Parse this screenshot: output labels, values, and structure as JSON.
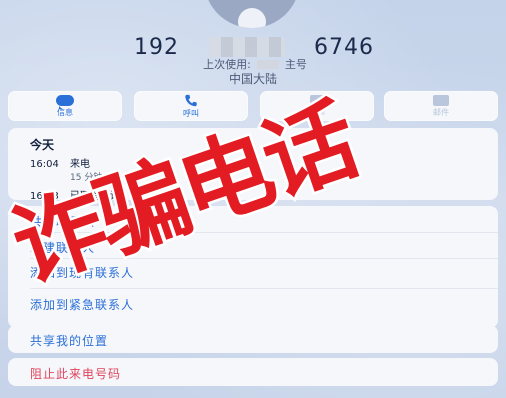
{
  "contact": {
    "number_prefix": "192",
    "number_suffix": "6746",
    "last_used_label": "上次使用:",
    "line_label": "主号",
    "region": "中国大陆"
  },
  "actions": [
    {
      "label": "信息",
      "icon": "message-bubble-icon",
      "enabled": true
    },
    {
      "label": "呼叫",
      "icon": "phone-icon",
      "enabled": true
    },
    {
      "label": "视频",
      "icon": "video-camera-icon",
      "enabled": false
    },
    {
      "label": "邮件",
      "icon": "mail-icon",
      "enabled": false
    }
  ],
  "recent_calls": {
    "day": "今天",
    "entries": [
      {
        "time": "16:04",
        "type": "来电",
        "duration": "15 分钟"
      },
      {
        "time": "16:03",
        "type": "已取消通话",
        "duration": ""
      }
    ]
  },
  "options": [
    "共享联系人",
    "新建联系人",
    "添加到现有联系人",
    "添加到紧急联系人",
    "共享我的位置"
  ],
  "block_label": "阻止此来电号码",
  "stamp_text": "诈骗电话",
  "colors": {
    "accent": "#2b6fd6",
    "danger": "#e0445c",
    "stamp": "#e31c24"
  }
}
